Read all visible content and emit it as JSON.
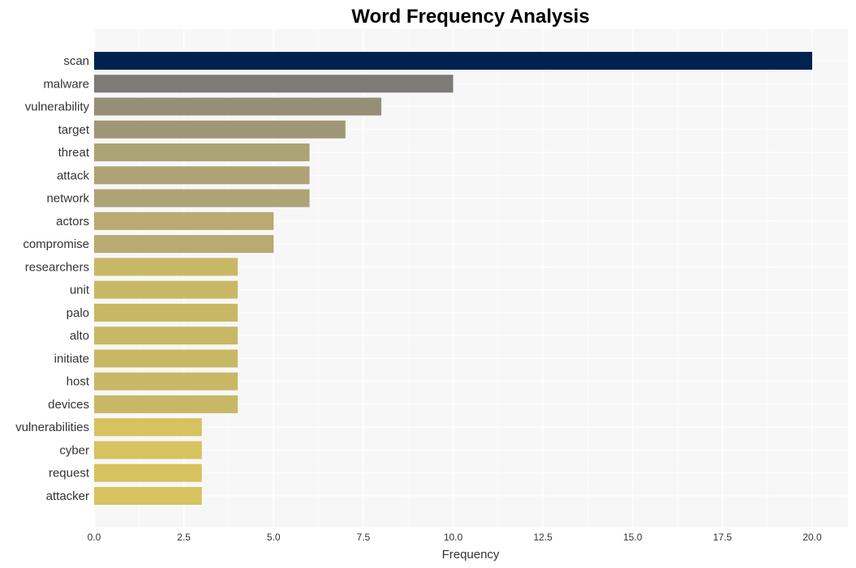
{
  "chart_data": {
    "type": "bar",
    "orientation": "horizontal",
    "title": "Word Frequency Analysis",
    "xlabel": "Frequency",
    "ylabel": "",
    "xlim": [
      0,
      21
    ],
    "xticks": [
      0.0,
      2.5,
      5.0,
      7.5,
      10.0,
      12.5,
      15.0,
      17.5,
      20.0
    ],
    "xtick_labels": [
      "0.0",
      "2.5",
      "5.0",
      "7.5",
      "10.0",
      "12.5",
      "15.0",
      "17.5",
      "20.0"
    ],
    "grid": true,
    "legend": "none",
    "categories": [
      "scan",
      "malware",
      "vulnerability",
      "target",
      "threat",
      "attack",
      "network",
      "actors",
      "compromise",
      "researchers",
      "unit",
      "palo",
      "alto",
      "initiate",
      "host",
      "devices",
      "vulnerabilities",
      "cyber",
      "request",
      "attacker"
    ],
    "values": [
      20,
      10,
      8,
      7,
      6,
      6,
      6,
      5,
      5,
      4,
      4,
      4,
      4,
      4,
      4,
      4,
      3,
      3,
      3,
      3
    ],
    "colors": [
      "#00224e",
      "#7c7b78",
      "#958f78",
      "#9f9677",
      "#ada374",
      "#ada374",
      "#ada374",
      "#b8aa70",
      "#b8aa70",
      "#c8b866",
      "#c8b866",
      "#c8b866",
      "#c8b866",
      "#c8b866",
      "#c8b866",
      "#c8b866",
      "#d6c25f",
      "#d6c25f",
      "#d6c25f",
      "#d6c25f"
    ],
    "background": "#f7f7f7",
    "grid_color": "#ffffff"
  }
}
